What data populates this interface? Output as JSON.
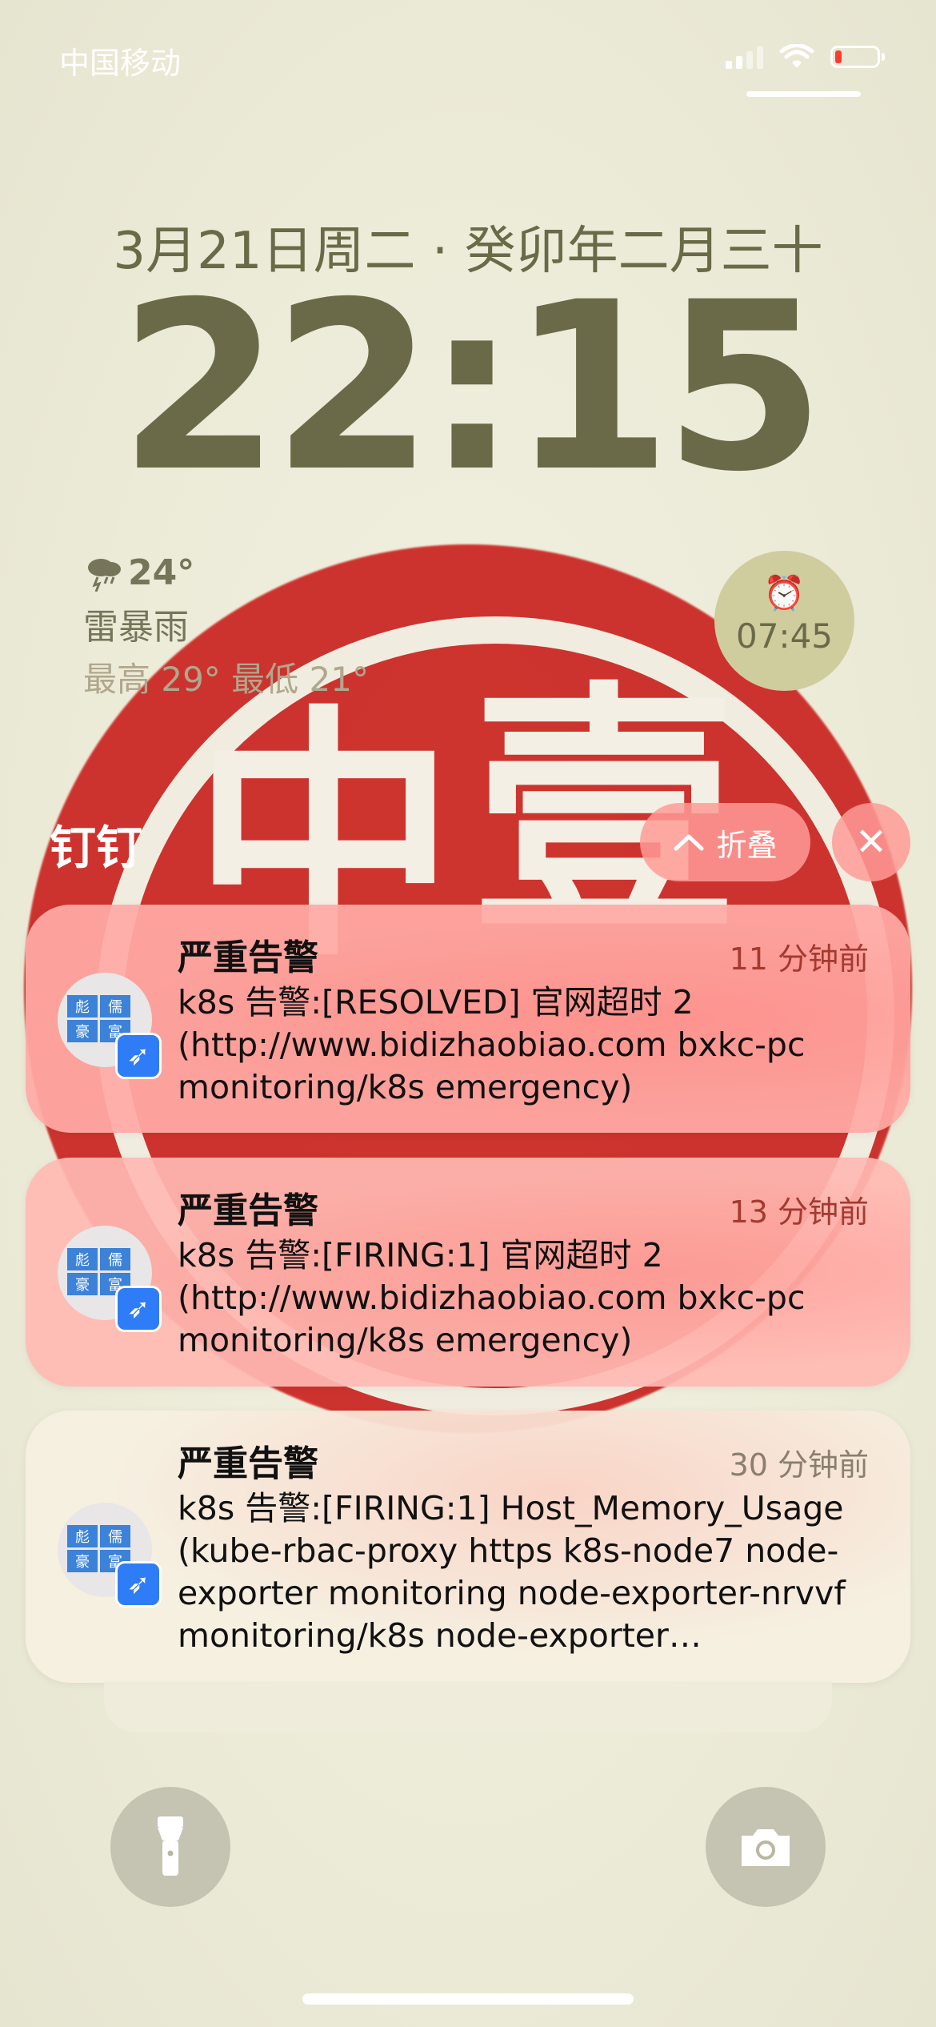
{
  "status_bar": {
    "carrier": "中国移动"
  },
  "lock": {
    "date": "3月21日周二 · 癸卯年二月三十",
    "time": "22:15"
  },
  "weather": {
    "temp": "24°",
    "condition": "雷暴雨",
    "hilo": "最高 29° 最低 21°"
  },
  "alarm": {
    "time": "07:45"
  },
  "group": {
    "app": "钉钉",
    "collapse_label": "折叠"
  },
  "icon_tiles": [
    "彪",
    "儒",
    "豪",
    "富"
  ],
  "notifications": [
    {
      "title": "严重告警",
      "time": "11 分钟前",
      "body": "k8s 告警:[RESOLVED] 官网超时 2 (http://www.bidizhaobiao.com bxkc-pc monitoring/k8s emergency)"
    },
    {
      "title": "严重告警",
      "time": "13 分钟前",
      "body": "k8s 告警:[FIRING:1] 官网超时 2 (http://www.bidizhaobiao.com bxkc-pc monitoring/k8s emergency)"
    },
    {
      "title": "严重告警",
      "time": "30 分钟前",
      "body": "k8s 告警:[FIRING:1] Host_Memory_Usage (kube-rbac-proxy https k8s-node7 node-exporter monitoring node-exporter-nrvvf monitoring/k8s node-exporter emergency)"
    }
  ],
  "wallpaper": {
    "stamp_chars": [
      "中",
      "壹"
    ]
  },
  "colors": {
    "stamp_red": "#cc2a25",
    "lock_text": "#6a6a48",
    "badge_blue": "#2e7cf6"
  }
}
